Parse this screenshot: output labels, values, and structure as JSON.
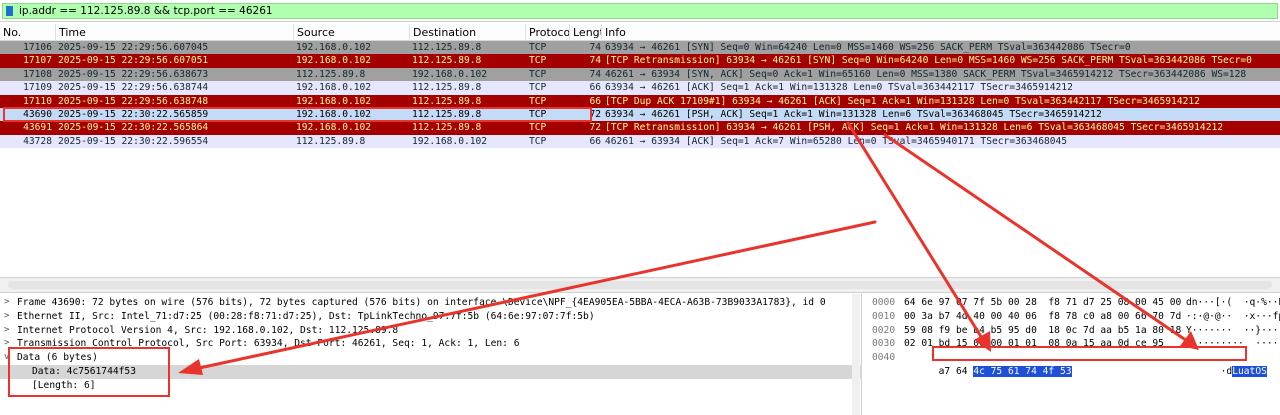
{
  "filter": {
    "text": "ip.addr == 112.125.89.8 && tcp.port == 46261"
  },
  "columns": [
    "No.",
    "Time",
    "Source",
    "Destination",
    "Protoco",
    "Lengt",
    "Info"
  ],
  "packets": [
    {
      "no": "17106",
      "time": "2025-09-15 22:29:56.607045",
      "src": "192.168.0.102",
      "dst": "112.125.89.8",
      "proto": "TCP",
      "len": "74",
      "info": "63934 → 46261 [SYN] Seq=0 Win=64240 Len=0 MSS=1460 WS=256 SACK_PERM TSval=363442086 TSecr=0",
      "scheme": "syn"
    },
    {
      "no": "17107",
      "time": "2025-09-15 22:29:56.607051",
      "src": "192.168.0.102",
      "dst": "112.125.89.8",
      "proto": "TCP",
      "len": "74",
      "info": "[TCP Retransmission] 63934 → 46261 [SYN] Seq=0 Win=64240 Len=0 MSS=1460 WS=256 SACK_PERM TSval=363442086 TSecr=0",
      "scheme": "bad"
    },
    {
      "no": "17108",
      "time": "2025-09-15 22:29:56.638673",
      "src": "112.125.89.8",
      "dst": "192.168.0.102",
      "proto": "TCP",
      "len": "74",
      "info": "46261 → 63934 [SYN, ACK] Seq=0 Ack=1 Win=65160 Len=0 MSS=1380 SACK_PERM TSval=3465914212 TSecr=363442086 WS=128",
      "scheme": "syn"
    },
    {
      "no": "17109",
      "time": "2025-09-15 22:29:56.638744",
      "src": "192.168.0.102",
      "dst": "112.125.89.8",
      "proto": "TCP",
      "len": "66",
      "info": "63934 → 46261 [ACK] Seq=1 Ack=1 Win=131328 Len=0 TSval=363442117 TSecr=3465914212",
      "scheme": "normal"
    },
    {
      "no": "17110",
      "time": "2025-09-15 22:29:56.638748",
      "src": "192.168.0.102",
      "dst": "112.125.89.8",
      "proto": "TCP",
      "len": "66",
      "info": "[TCP Dup ACK 17109#1] 63934 → 46261 [ACK] Seq=1 Ack=1 Win=131328 Len=0 TSval=363442117 TSecr=3465914212",
      "scheme": "bad"
    },
    {
      "no": "43690",
      "time": "2025-09-15 22:30:22.565859",
      "src": "192.168.0.102",
      "dst": "112.125.89.8",
      "proto": "TCP",
      "len": "72",
      "info": "63934 → 46261 [PSH, ACK] Seq=1 Ack=1 Win=131328 Len=6 TSval=363468045 TSecr=3465914212",
      "scheme": "selected"
    },
    {
      "no": "43691",
      "time": "2025-09-15 22:30:22.565864",
      "src": "192.168.0.102",
      "dst": "112.125.89.8",
      "proto": "TCP",
      "len": "72",
      "info": "[TCP Retransmission] 63934 → 46261 [PSH, ACK] Seq=1 Ack=1 Win=131328 Len=6 TSval=363468045 TSecr=3465914212",
      "scheme": "bad"
    },
    {
      "no": "43728",
      "time": "2025-09-15 22:30:22.596554",
      "src": "112.125.89.8",
      "dst": "192.168.0.102",
      "proto": "TCP",
      "len": "66",
      "info": "46261 → 63934 [ACK] Seq=1 Ack=7 Win=65280 Len=0 TSval=3465940171 TSecr=363468045",
      "scheme": "normal"
    }
  ],
  "details": [
    {
      "twisty": ">",
      "text": "Frame 43690: 72 bytes on wire (576 bits), 72 bytes captured (576 bits) on interface \\Device\\NPF_{4EA905EA-5BBA-4ECA-A63B-73B9033A1783}, id 0"
    },
    {
      "twisty": ">",
      "text": "Ethernet II, Src: Intel_71:d7:25 (00:28:f8:71:d7:25), Dst: TpLinkTechno_97:7f:5b (64:6e:97:07:7f:5b)"
    },
    {
      "twisty": ">",
      "text": "Internet Protocol Version 4, Src: 192.168.0.102, Dst: 112.125.89.8"
    },
    {
      "twisty": ">",
      "text": "Transmission Control Protocol, Src Port: 63934, Dst Port: 46261, Seq: 1, Ack: 1, Len: 6"
    },
    {
      "twisty": "v",
      "text": "Data (6 bytes)"
    },
    {
      "twisty": "",
      "text": "Data: 4c7561744f53",
      "child": true,
      "selected": true
    },
    {
      "twisty": "",
      "text": "[Length: 6]",
      "child": true
    }
  ],
  "bytes": [
    {
      "offset": "0000",
      "hex": "64 6e 97 07 7f 5b 00 28  f8 71 d7 25 08 00 45 00",
      "ascii": "dn···[·(  ·q·%··E·"
    },
    {
      "offset": "0010",
      "hex": "00 3a b7 4d 40 00 40 06  f8 78 c0 a8 00 66 70 7d",
      "ascii": "·:·@·@··  ·x···fp}"
    },
    {
      "offset": "0020",
      "hex": "59 08 f9 be b4 b5 95 d0  18 0c 7d aa b5 1a 80 18",
      "ascii": "Y·······  ··}·····"
    },
    {
      "offset": "0030",
      "hex": "02 01 bd 15 00 00 01 01  08 0a 15 aa 0d ce 95",
      "ascii": "··········  ······"
    },
    {
      "offset": "0040",
      "hex_plain": "a7 64 ",
      "hex_hl": "4c 75 61 74 4f 53",
      "ascii_plain": "·d",
      "ascii_hl": "LuatOS"
    }
  ],
  "colors": {
    "filter_bg": "#afffaf",
    "syn_row": "#a0a0a0",
    "bad_row": "#a40000",
    "bad_text": "#fffc9c",
    "normal_row": "#e7e6ff",
    "selected_row": "#c4dbf7",
    "byte_highlight": "#1d4fd8",
    "annotation": "#e8342c"
  }
}
